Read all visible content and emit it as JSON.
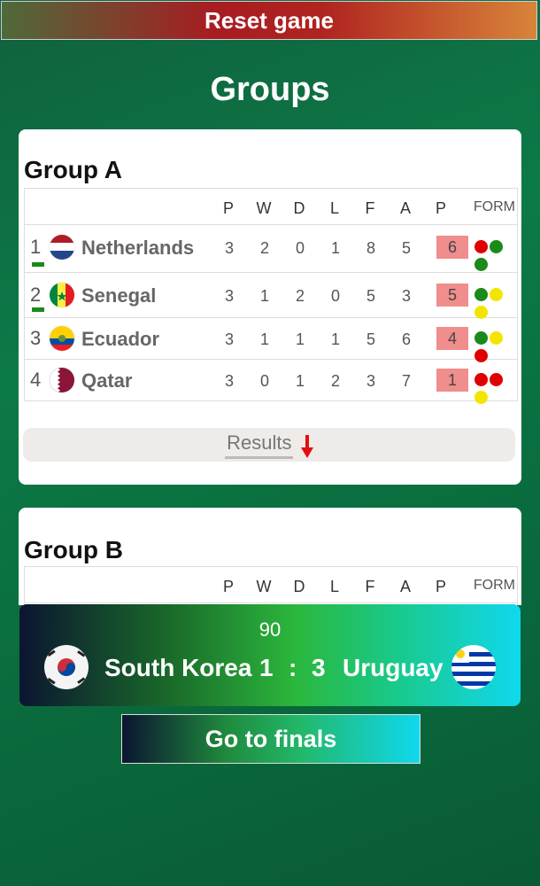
{
  "header": {
    "reset_label": "Reset game"
  },
  "title": "Groups",
  "columns": {
    "p": "P",
    "w": "W",
    "d": "D",
    "l": "L",
    "f": "F",
    "a": "A",
    "pts": "P",
    "form": "FORM"
  },
  "group_a": {
    "title": "Group A",
    "rows": [
      {
        "pos": "1",
        "team": "Netherlands",
        "p": "3",
        "w": "2",
        "d": "0",
        "l": "1",
        "f": "8",
        "a": "5",
        "pts": "6"
      },
      {
        "pos": "2",
        "team": "Senegal",
        "p": "3",
        "w": "1",
        "d": "2",
        "l": "0",
        "f": "5",
        "a": "3",
        "pts": "5"
      },
      {
        "pos": "3",
        "team": "Ecuador",
        "p": "3",
        "w": "1",
        "d": "1",
        "l": "1",
        "f": "5",
        "a": "6",
        "pts": "4"
      },
      {
        "pos": "4",
        "team": "Qatar",
        "p": "3",
        "w": "0",
        "d": "1",
        "l": "2",
        "f": "3",
        "a": "7",
        "pts": "1"
      }
    ],
    "results_label": "Results"
  },
  "group_b": {
    "title": "Group B"
  },
  "live_match": {
    "minute": "90",
    "home": "South Korea",
    "home_score": "1",
    "separator": ":",
    "away_score": "3",
    "away": "Uruguay"
  },
  "finals_label": "Go to finals",
  "colors": {
    "win": "#1a8a1a",
    "draw": "#f2e600",
    "loss": "#e00000",
    "points_bg": "#f08d8d"
  }
}
